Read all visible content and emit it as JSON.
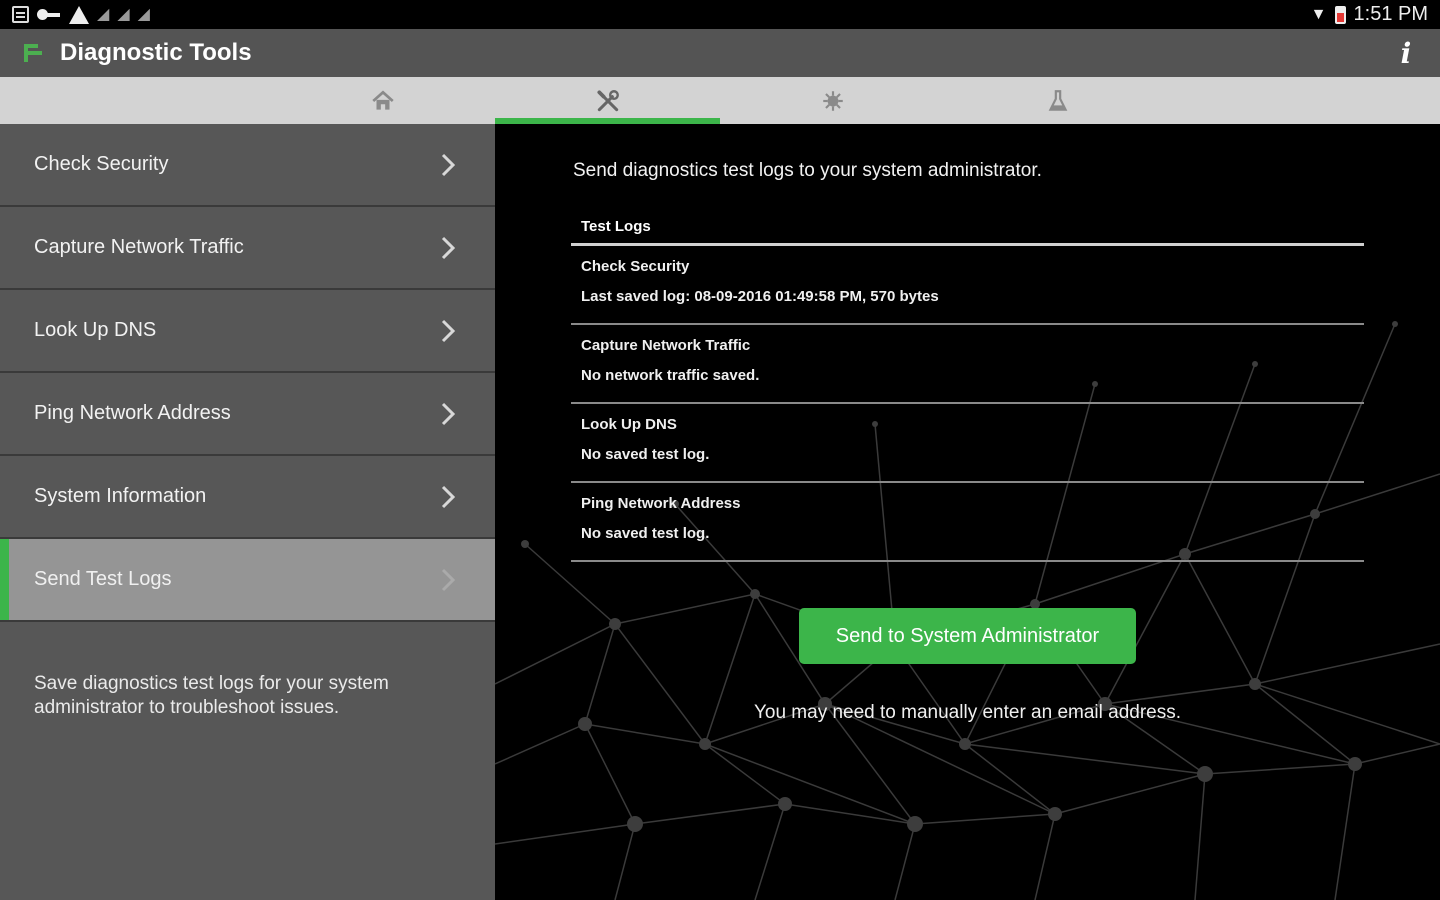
{
  "status_bar": {
    "time": "1:51 PM",
    "left_icons": [
      "notes-icon",
      "key-icon",
      "warning-icon",
      "signal-icon",
      "signal-icon",
      "signal-icon"
    ],
    "right_icons": [
      "wifi-icon",
      "battery-icon"
    ]
  },
  "action_bar": {
    "title": "Diagnostic Tools",
    "info_label": "i"
  },
  "tabs": [
    {
      "name": "home",
      "icon": "home-icon",
      "active": false
    },
    {
      "name": "tools",
      "icon": "tools-icon",
      "active": true
    },
    {
      "name": "virus",
      "icon": "virus-icon",
      "active": false
    },
    {
      "name": "lab",
      "icon": "flask-icon",
      "active": false
    }
  ],
  "sidebar": {
    "items": [
      {
        "label": "Check Security"
      },
      {
        "label": "Capture Network Traffic"
      },
      {
        "label": "Look Up DNS"
      },
      {
        "label": "Ping Network Address"
      },
      {
        "label": "System Information"
      },
      {
        "label": "Send Test Logs",
        "active": true
      }
    ],
    "description": "Save diagnostics test logs for your system administrator to troubleshoot issues."
  },
  "content": {
    "intro": "Send diagnostics test logs to your system administrator.",
    "table_header": "Test Logs",
    "logs": [
      {
        "name": "Check Security",
        "status": "Last saved log: 08-09-2016 01:49:58 PM, 570 bytes"
      },
      {
        "name": "Capture Network Traffic",
        "status": "No network traffic saved."
      },
      {
        "name": "Look Up DNS",
        "status": "No saved test log."
      },
      {
        "name": "Ping Network Address",
        "status": "No saved test log."
      }
    ],
    "send_button": "Send to System Administrator",
    "email_note": "You may need to manually enter an email address."
  },
  "colors": {
    "accent": "#3cb54a",
    "action_bar": "#545454",
    "tab_bar": "#d3d3d3",
    "sidebar": "#575757",
    "sidebar_active": "#959595"
  }
}
